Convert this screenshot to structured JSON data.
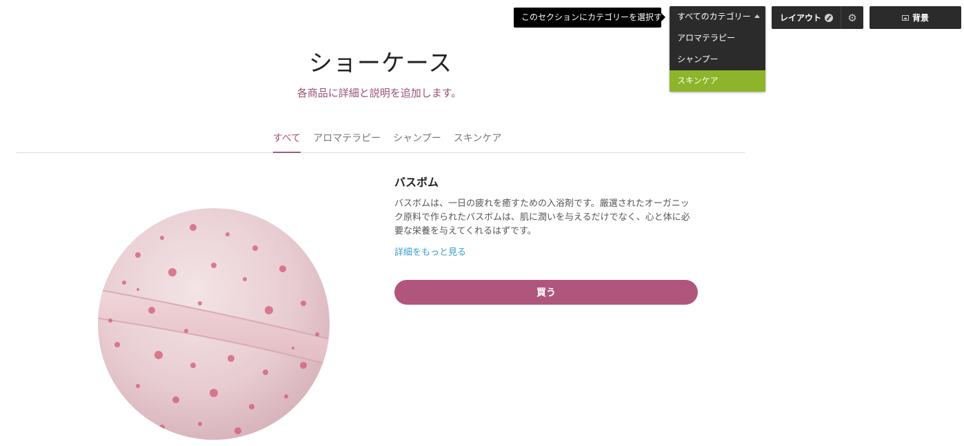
{
  "toolbar": {
    "tooltip": "このセクションにカテゴリーを選択する",
    "category_dropdown": {
      "selected_label": "すべてのカテゴリー",
      "options": [
        "アロマテラピー",
        "シャンプー",
        "スキンケア"
      ],
      "highlighted_option": "スキンケア"
    },
    "layout_label": "レイアウト",
    "background_label": "背景"
  },
  "showcase": {
    "title": "ショーケース",
    "subtitle": "各商品に詳細と説明を追加します。",
    "tabs": [
      "すべて",
      "アロマテラピー",
      "シャンプー",
      "スキンケア"
    ],
    "active_tab": "すべて"
  },
  "product": {
    "name": "バスボム",
    "description": "バスボムは、一日の疲れを癒すための入浴剤です。厳選されたオーガニック原料で作られたバスボムは、肌に潤いを与えるだけでなく、心と体に必要な栄養を与えてくれるはずです。",
    "more_link": "詳細をもっと見る",
    "buy_label": "買う"
  },
  "colors": {
    "accent": "#b0567c",
    "tab_active": "#a0577b",
    "link": "#3aa0c6",
    "dropdown_highlight": "#8db42a",
    "toolbar_bg": "#2b2b2b"
  }
}
